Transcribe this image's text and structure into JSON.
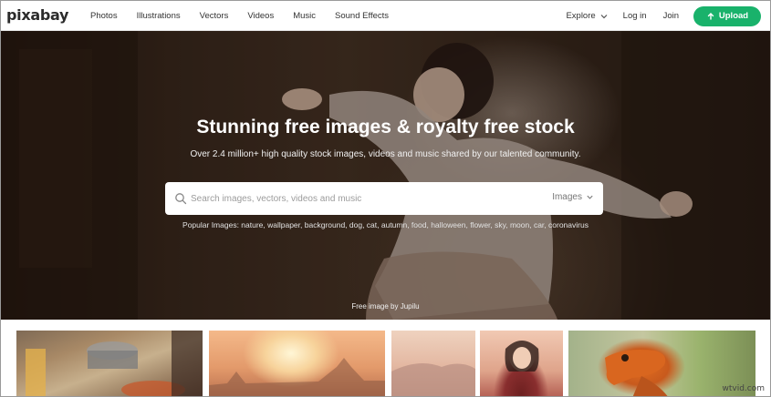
{
  "header": {
    "logo": "pixabay",
    "nav": [
      "Photos",
      "Illustrations",
      "Vectors",
      "Videos",
      "Music",
      "Sound Effects"
    ],
    "explore": "Explore",
    "login": "Log in",
    "join": "Join",
    "upload": "Upload"
  },
  "hero": {
    "title": "Stunning free images & royalty free stock",
    "subtitle": "Over 2.4 million+ high quality stock images, videos and music shared by our talented community.",
    "search": {
      "placeholder": "Search images, vectors, videos and music",
      "type": "Images"
    },
    "popular": "Popular Images: nature, wallpaper, background, dog, cat, autumn, food, halloween, flower, sky, moon, car, coronavirus",
    "credit": "Free image by Jupilu"
  },
  "watermark": "wtvid.com",
  "colors": {
    "accent": "#19b26b"
  },
  "icons": {
    "search": "search-icon",
    "chevron": "chevron-down-icon",
    "upload": "upload-icon"
  }
}
